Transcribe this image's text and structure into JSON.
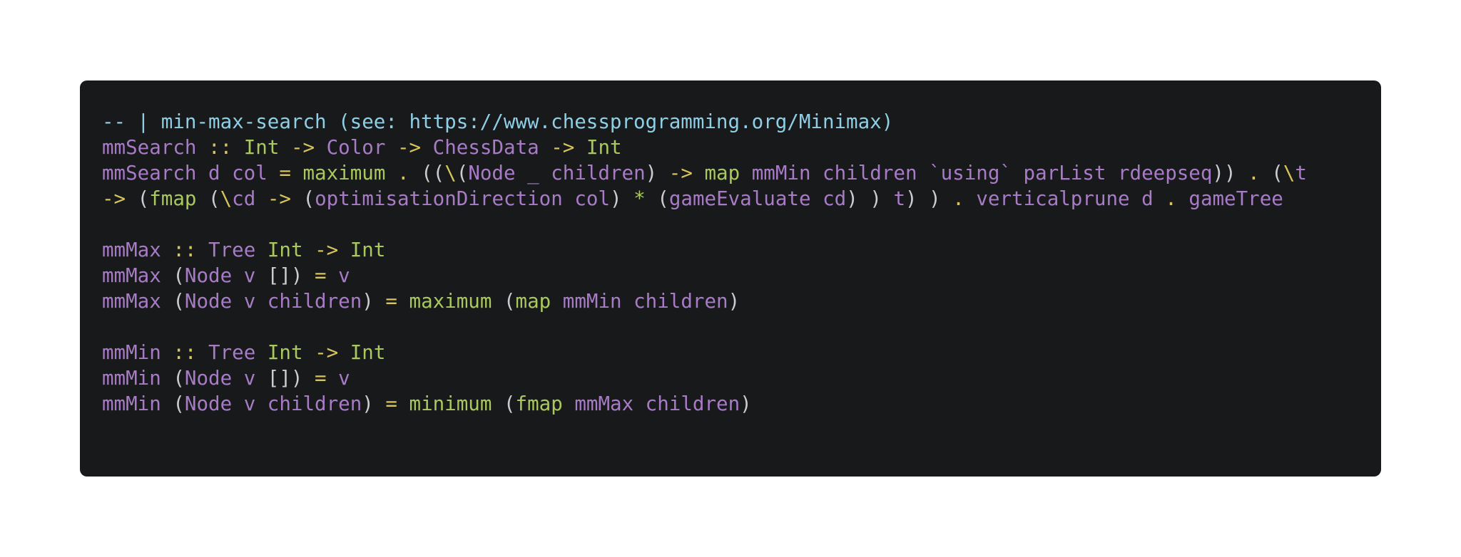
{
  "colors": {
    "background": "#ffffff",
    "panel": "#18191b",
    "comment": "#8ecfe6",
    "identifier": "#a77bc6",
    "operator": "#d7c45c",
    "function": "#a9c85d",
    "punctuation": "#c9ccd0"
  },
  "code": {
    "lines": [
      [
        [
          "c",
          "-- | min-max-search (see: https://www.chessprogramming.org/Minimax)"
        ]
      ],
      [
        [
          "i",
          "mmSearch "
        ],
        [
          "k",
          "::"
        ],
        [
          "p",
          " "
        ],
        [
          "f",
          "Int"
        ],
        [
          "p",
          " "
        ],
        [
          "k",
          "->"
        ],
        [
          "p",
          " "
        ],
        [
          "i",
          "Color"
        ],
        [
          "p",
          " "
        ],
        [
          "k",
          "->"
        ],
        [
          "p",
          " "
        ],
        [
          "i",
          "ChessData"
        ],
        [
          "p",
          " "
        ],
        [
          "k",
          "->"
        ],
        [
          "p",
          " "
        ],
        [
          "f",
          "Int"
        ]
      ],
      [
        [
          "i",
          "mmSearch d col "
        ],
        [
          "k",
          "="
        ],
        [
          "p",
          " "
        ],
        [
          "f",
          "maximum"
        ],
        [
          "p",
          " "
        ],
        [
          "k",
          "."
        ],
        [
          "p",
          " (("
        ],
        [
          "k",
          "\\"
        ],
        [
          "p",
          "("
        ],
        [
          "i",
          "Node _ children"
        ],
        [
          "p",
          ") "
        ],
        [
          "k",
          "->"
        ],
        [
          "p",
          " "
        ],
        [
          "f",
          "map"
        ],
        [
          "p",
          " "
        ],
        [
          "i",
          "mmMin children `using` parList rdeepseq"
        ],
        [
          "p",
          ")) "
        ],
        [
          "k",
          "."
        ],
        [
          "p",
          " ("
        ],
        [
          "k",
          "\\"
        ],
        [
          "i",
          "t"
        ]
      ],
      [
        [
          "k",
          "->"
        ],
        [
          "p",
          " ("
        ],
        [
          "f",
          "fmap"
        ],
        [
          "p",
          " ("
        ],
        [
          "k",
          "\\"
        ],
        [
          "i",
          "cd"
        ],
        [
          "p",
          " "
        ],
        [
          "k",
          "->"
        ],
        [
          "p",
          " ("
        ],
        [
          "i",
          "optimisationDirection col"
        ],
        [
          "p",
          ") "
        ],
        [
          "f",
          "*"
        ],
        [
          "p",
          " ("
        ],
        [
          "i",
          "gameEvaluate cd"
        ],
        [
          "p",
          ") ) "
        ],
        [
          "i",
          "t"
        ],
        [
          "p",
          ") ) "
        ],
        [
          "k",
          "."
        ],
        [
          "p",
          " "
        ],
        [
          "i",
          "verticalprune d "
        ],
        [
          "k",
          "."
        ],
        [
          "p",
          " "
        ],
        [
          "i",
          "gameTree"
        ]
      ],
      [],
      [
        [
          "i",
          "mmMax "
        ],
        [
          "k",
          "::"
        ],
        [
          "p",
          " "
        ],
        [
          "i",
          "Tree"
        ],
        [
          "p",
          " "
        ],
        [
          "f",
          "Int"
        ],
        [
          "p",
          " "
        ],
        [
          "k",
          "->"
        ],
        [
          "p",
          " "
        ],
        [
          "f",
          "Int"
        ]
      ],
      [
        [
          "i",
          "mmMax "
        ],
        [
          "p",
          "("
        ],
        [
          "i",
          "Node v"
        ],
        [
          "p",
          " []) "
        ],
        [
          "k",
          "="
        ],
        [
          "p",
          " "
        ],
        [
          "i",
          "v"
        ]
      ],
      [
        [
          "i",
          "mmMax "
        ],
        [
          "p",
          "("
        ],
        [
          "i",
          "Node v children"
        ],
        [
          "p",
          ") "
        ],
        [
          "k",
          "="
        ],
        [
          "p",
          " "
        ],
        [
          "f",
          "maximum"
        ],
        [
          "p",
          " ("
        ],
        [
          "f",
          "map"
        ],
        [
          "p",
          " "
        ],
        [
          "i",
          "mmMin children"
        ],
        [
          "p",
          ")"
        ]
      ],
      [],
      [
        [
          "i",
          "mmMin "
        ],
        [
          "k",
          "::"
        ],
        [
          "p",
          " "
        ],
        [
          "i",
          "Tree"
        ],
        [
          "p",
          " "
        ],
        [
          "f",
          "Int"
        ],
        [
          "p",
          " "
        ],
        [
          "k",
          "->"
        ],
        [
          "p",
          " "
        ],
        [
          "f",
          "Int"
        ]
      ],
      [
        [
          "i",
          "mmMin "
        ],
        [
          "p",
          "("
        ],
        [
          "i",
          "Node v"
        ],
        [
          "p",
          " []) "
        ],
        [
          "k",
          "="
        ],
        [
          "p",
          " "
        ],
        [
          "i",
          "v"
        ]
      ],
      [
        [
          "i",
          "mmMin "
        ],
        [
          "p",
          "("
        ],
        [
          "i",
          "Node v children"
        ],
        [
          "p",
          ") "
        ],
        [
          "k",
          "="
        ],
        [
          "p",
          " "
        ],
        [
          "f",
          "minimum"
        ],
        [
          "p",
          " ("
        ],
        [
          "f",
          "fmap"
        ],
        [
          "p",
          " "
        ],
        [
          "i",
          "mmMax children"
        ],
        [
          "p",
          ")"
        ]
      ]
    ]
  }
}
